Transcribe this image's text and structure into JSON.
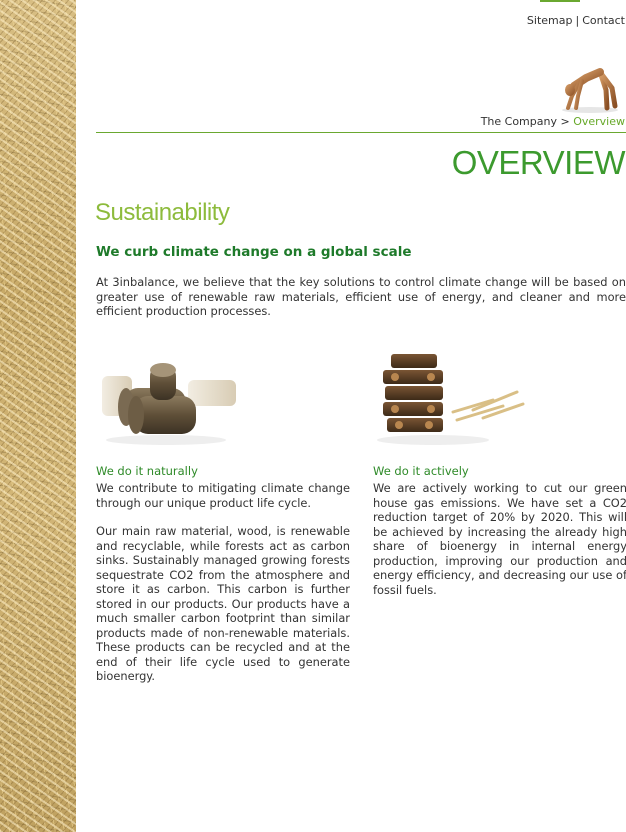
{
  "top_links": {
    "sitemap": "Sitemap",
    "separator": "|",
    "contact": "Contact"
  },
  "breadcrumb": {
    "parent": "The Company",
    "separator": ">",
    "current": "Overview"
  },
  "page_title": "OVERVIEW",
  "section_title": "Sustainability",
  "subheading": "We curb climate change on a global scale",
  "intro": "At 3inbalance, we believe that the key solutions to control climate change will be based on greater use of renewable raw materials, efficient use of energy, and cleaner and more efficient production processes.",
  "columns": [
    {
      "heading": "We do it naturally",
      "paragraphs": [
        "We contribute to mitigating climate change through our unique product life cycle.",
        "Our main raw material, wood, is renewable and recyclable, while forests act as carbon sinks. Sustainably managed growing forests sequestrate CO2 from the atmosphere and store it as carbon. This carbon is further stored in our products. Our products have a much smaller carbon footprint than similar products made of non-renewable materials. These products can be recycled and at the end of their life cycle used to generate bioenergy."
      ]
    },
    {
      "heading": "We do it actively",
      "paragraphs": [
        "We are actively working to cut our green house gas emissions. We have set a CO2 reduction target of 20% by 2020. This will be achieved by increasing the already high share of bioenergy in internal energy production, improving our production and energy efficiency, and decreasing our use of fossil fuels."
      ]
    }
  ]
}
